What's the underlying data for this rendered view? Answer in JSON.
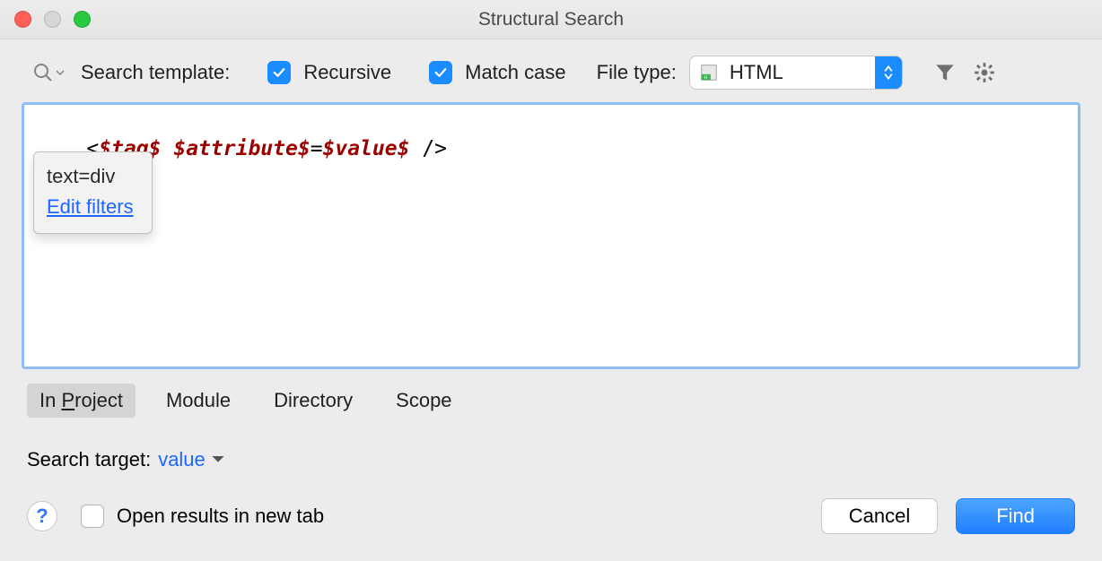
{
  "window": {
    "title": "Structural Search"
  },
  "toolbar": {
    "search_template_label": "Search template:",
    "recursive_label": "Recursive",
    "recursive_checked": true,
    "match_case_label": "Match case",
    "match_case_checked": true,
    "file_type_label": "File type:",
    "file_type_value": "HTML"
  },
  "template_code": {
    "open": "<",
    "tag_var": "$tag$",
    "space": " ",
    "attr_var": "$attribute$",
    "eq": "=",
    "value_var": "$value$",
    "close": " />"
  },
  "popup": {
    "filter_line": "text=div",
    "edit_filters": "Edit filters"
  },
  "scope_tabs": {
    "in_project": "In Project",
    "module": "Module",
    "directory": "Directory",
    "scope": "Scope",
    "active": "in_project"
  },
  "search_target": {
    "label": "Search target:",
    "value": "value"
  },
  "footer": {
    "open_new_tab": "Open results in new tab",
    "open_new_tab_checked": false,
    "cancel": "Cancel",
    "find": "Find"
  }
}
